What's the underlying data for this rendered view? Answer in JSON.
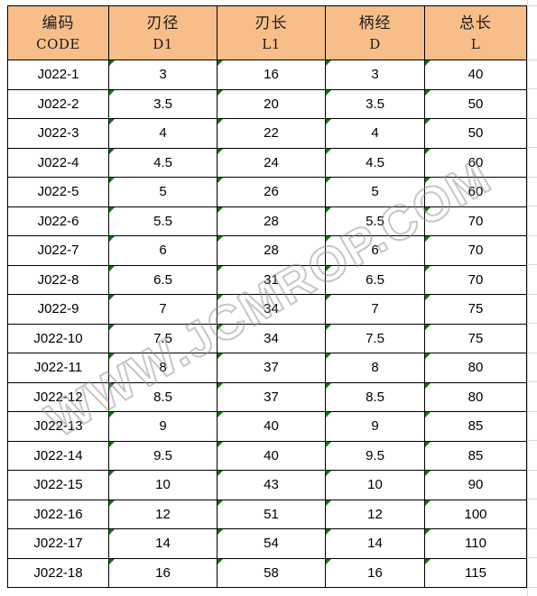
{
  "watermark": {
    "text": "WWW.JCMROP.COM"
  },
  "table": {
    "accent_header_color": "#F8BE8A",
    "border_color": "#000000",
    "marker_color": "#0B7A0B",
    "columns": [
      {
        "key": "code",
        "cn": "编码",
        "en": "CODE",
        "marked": false
      },
      {
        "key": "d1",
        "cn": "刃径",
        "en": "D1",
        "marked": true
      },
      {
        "key": "l1",
        "cn": "刃长",
        "en": "L1",
        "marked": true
      },
      {
        "key": "d",
        "cn": "柄经",
        "en": "D",
        "marked": true
      },
      {
        "key": "l",
        "cn": "总长",
        "en": "L",
        "marked": true
      }
    ],
    "rows": [
      {
        "code": "J022-1",
        "d1": "3",
        "l1": "16",
        "d": "3",
        "l": "40"
      },
      {
        "code": "J022-2",
        "d1": "3.5",
        "l1": "20",
        "d": "3.5",
        "l": "50"
      },
      {
        "code": "J022-3",
        "d1": "4",
        "l1": "22",
        "d": "4",
        "l": "50"
      },
      {
        "code": "J022-4",
        "d1": "4.5",
        "l1": "24",
        "d": "4.5",
        "l": "60"
      },
      {
        "code": "J022-5",
        "d1": "5",
        "l1": "26",
        "d": "5",
        "l": "60"
      },
      {
        "code": "J022-6",
        "d1": "5.5",
        "l1": "28",
        "d": "5.5",
        "l": "70"
      },
      {
        "code": "J022-7",
        "d1": "6",
        "l1": "28",
        "d": "6",
        "l": "70"
      },
      {
        "code": "J022-8",
        "d1": "6.5",
        "l1": "31",
        "d": "6.5",
        "l": "70"
      },
      {
        "code": "J022-9",
        "d1": "7",
        "l1": "34",
        "d": "7",
        "l": "75"
      },
      {
        "code": "J022-10",
        "d1": "7.5",
        "l1": "34",
        "d": "7.5",
        "l": "75"
      },
      {
        "code": "J022-11",
        "d1": "8",
        "l1": "37",
        "d": "8",
        "l": "80"
      },
      {
        "code": "J022-12",
        "d1": "8.5",
        "l1": "37",
        "d": "8.5",
        "l": "80"
      },
      {
        "code": "J022-13",
        "d1": "9",
        "l1": "40",
        "d": "9",
        "l": "85"
      },
      {
        "code": "J022-14",
        "d1": "9.5",
        "l1": "40",
        "d": "9.5",
        "l": "85"
      },
      {
        "code": "J022-15",
        "d1": "10",
        "l1": "43",
        "d": "10",
        "l": "90"
      },
      {
        "code": "J022-16",
        "d1": "12",
        "l1": "51",
        "d": "12",
        "l": "100"
      },
      {
        "code": "J022-17",
        "d1": "14",
        "l1": "54",
        "d": "14",
        "l": "110"
      },
      {
        "code": "J022-18",
        "d1": "16",
        "l1": "58",
        "d": "16",
        "l": "115"
      }
    ]
  }
}
